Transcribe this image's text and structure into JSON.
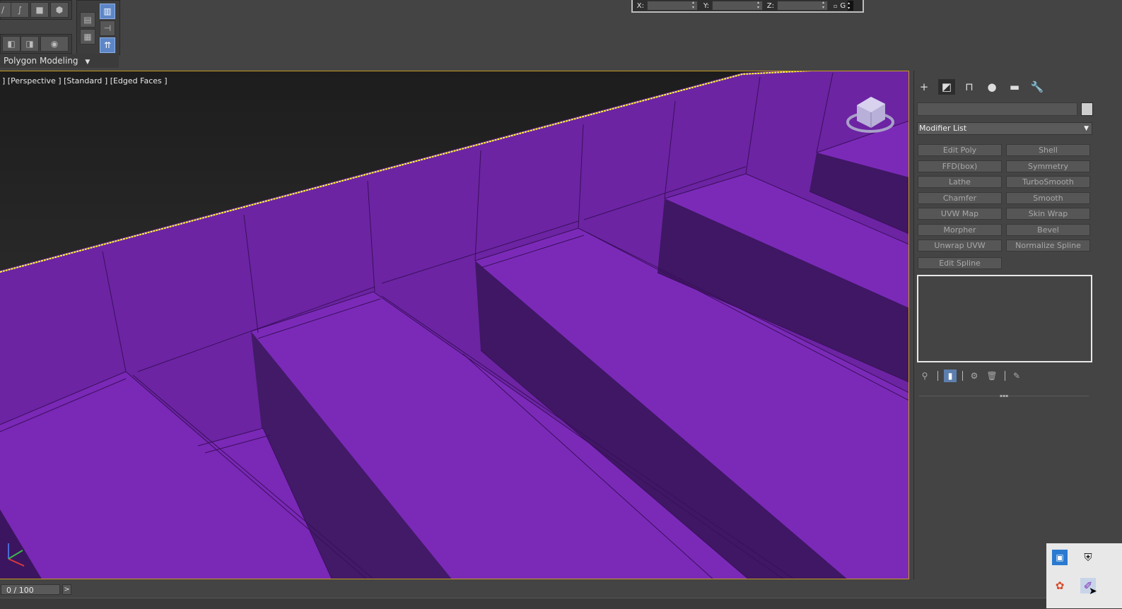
{
  "ribbon": {
    "label": "Polygon Modeling"
  },
  "coords": {
    "x_label": "X:",
    "y_label": "Y:",
    "z_label": "Z:",
    "g_label": "G"
  },
  "viewport": {
    "label": "] [Perspective ] [Standard ] [Edged Faces ]",
    "object_color": "#7a28b6",
    "selection_color": "#ffff33",
    "border_color": "#c59a20"
  },
  "command_panel": {
    "tabs": [
      {
        "name": "create-tab-plus-icon",
        "glyph": "+"
      },
      {
        "name": "modify-tab-icon",
        "glyph": "◩"
      },
      {
        "name": "hierarchy-tab-icon",
        "glyph": "⊓"
      },
      {
        "name": "motion-tab-icon",
        "glyph": "●"
      },
      {
        "name": "display-tab-icon",
        "glyph": "▬"
      },
      {
        "name": "utilities-tab-icon",
        "glyph": "🔧"
      }
    ],
    "modifier_list": "Modifier List",
    "modifiers": [
      "Edit Poly",
      "Shell",
      "FFD(box)",
      "Symmetry",
      "Lathe",
      "TurboSmooth",
      "Chamfer",
      "Smooth",
      "UVW Map",
      "Skin Wrap",
      "Morpher",
      "Bevel",
      "Unwrap UVW",
      "Normalize Spline",
      "Edit Spline"
    ]
  },
  "timeline": {
    "frame": "0 / 100",
    "next": ">"
  }
}
